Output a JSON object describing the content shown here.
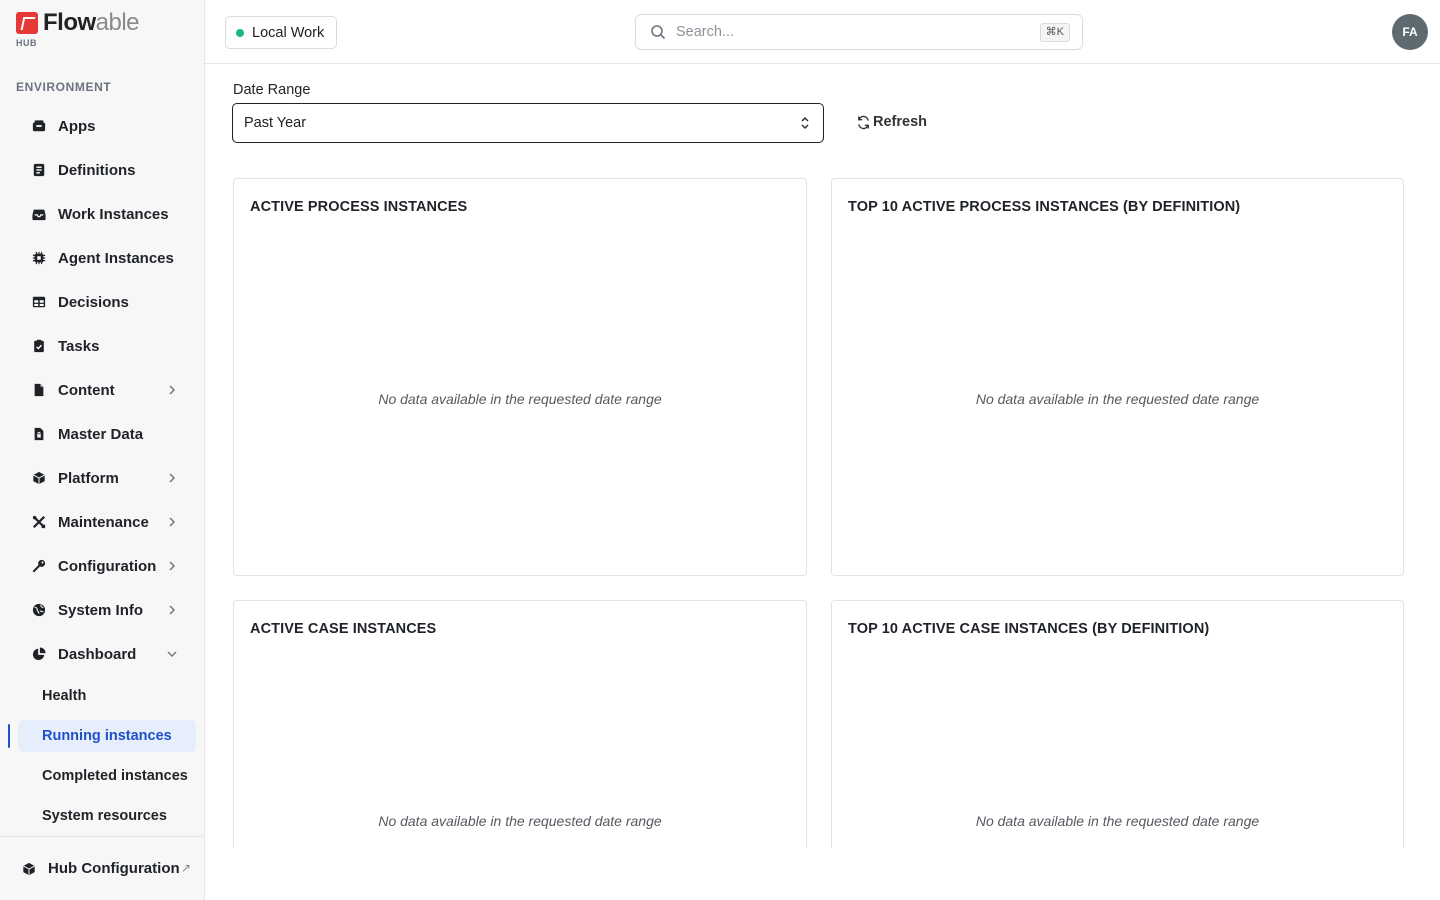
{
  "brand": {
    "name_main": "Flow",
    "name_accent": "able",
    "sub": "HUB",
    "accent_color": "#e53935"
  },
  "sidebar": {
    "section_label": "ENVIRONMENT",
    "items": [
      {
        "label": "Apps",
        "icon": "apps-icon",
        "chevron": false
      },
      {
        "label": "Definitions",
        "icon": "definitions-icon",
        "chevron": false
      },
      {
        "label": "Work Instances",
        "icon": "inbox-icon",
        "chevron": false
      },
      {
        "label": "Agent Instances",
        "icon": "chip-icon",
        "chevron": false
      },
      {
        "label": "Decisions",
        "icon": "table-icon",
        "chevron": false
      },
      {
        "label": "Tasks",
        "icon": "clipboard-check-icon",
        "chevron": false
      },
      {
        "label": "Content",
        "icon": "file-icon",
        "chevron": true
      },
      {
        "label": "Master Data",
        "icon": "file-lock-icon",
        "chevron": false
      },
      {
        "label": "Platform",
        "icon": "cube-icon",
        "chevron": true
      },
      {
        "label": "Maintenance",
        "icon": "tools-icon",
        "chevron": true
      },
      {
        "label": "Configuration",
        "icon": "key-icon",
        "chevron": true
      },
      {
        "label": "System Info",
        "icon": "globe-icon",
        "chevron": true
      },
      {
        "label": "Dashboard",
        "icon": "pie-chart-icon",
        "chevron": "down"
      }
    ],
    "dashboard_sub_items": [
      {
        "label": "Health",
        "active": false
      },
      {
        "label": "Running instances",
        "active": true
      },
      {
        "label": "Completed instances",
        "active": false
      },
      {
        "label": "System resources",
        "active": false
      }
    ],
    "footer": {
      "label": "Hub Configuration",
      "external": "↗"
    }
  },
  "topbar": {
    "environment": "Local Work",
    "environment_status_color": "#18b58a",
    "search_placeholder": "Search...",
    "search_shortcut": "⌘K",
    "avatar_initials": "FA"
  },
  "main": {
    "date_range_label": "Date Range",
    "date_range_value": "Past Year",
    "refresh_label": "Refresh",
    "cards": [
      {
        "title": "ACTIVE PROCESS INSTANCES",
        "empty_text": "No data available in the requested date range"
      },
      {
        "title": "TOP 10 ACTIVE PROCESS INSTANCES (BY DEFINITION)",
        "empty_text": "No data available in the requested date range"
      },
      {
        "title": "ACTIVE CASE INSTANCES",
        "empty_text": "No data available in the requested date range"
      },
      {
        "title": "TOP 10 ACTIVE CASE INSTANCES (BY DEFINITION)",
        "empty_text": "No data available in the requested date range"
      }
    ]
  }
}
